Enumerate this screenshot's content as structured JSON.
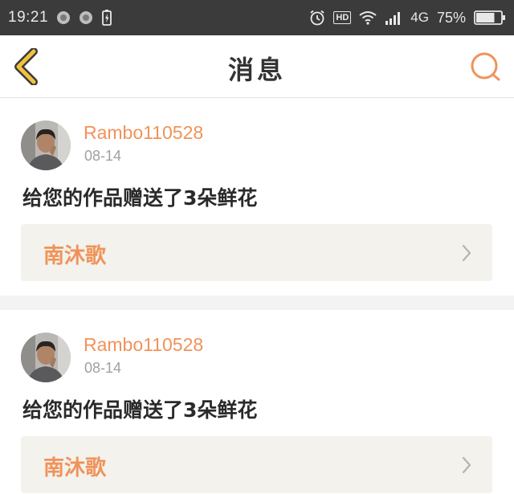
{
  "status_bar": {
    "time": "19:21",
    "hd": "HD",
    "network": "4G",
    "battery_percent": "75%",
    "battery_level": 0.75
  },
  "nav": {
    "title": "消息"
  },
  "notifications": [
    {
      "username": "Rambo110528",
      "date": "08-14",
      "message": "给您的作品赠送了3朵鲜花",
      "work_title": "南沐歌"
    },
    {
      "username": "Rambo110528",
      "date": "08-14",
      "message": "给您的作品赠送了3朵鲜花",
      "work_title": "南沐歌"
    }
  ],
  "colors": {
    "accent": "#f0935a",
    "back_arrow": "#f2c23c",
    "status_bar": "#3b3b3b"
  }
}
